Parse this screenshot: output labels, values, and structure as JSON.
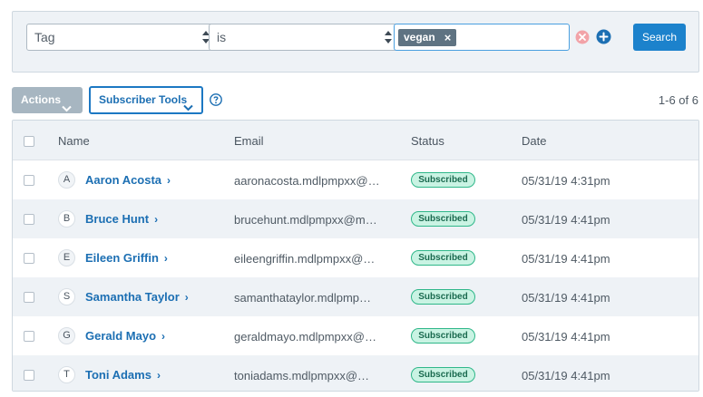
{
  "filter": {
    "field_value": "Tag",
    "operator_value": "is",
    "tag_chip": "vegan",
    "tag_remove_glyph": "×",
    "search_label": "Search",
    "clear_icon": "clear-circle-icon",
    "add_icon": "add-circle-icon"
  },
  "toolbar": {
    "actions_label": "Actions",
    "subscriber_tools_label": "Subscriber Tools",
    "help_icon": "question-circle-icon",
    "pagination": "1-6 of 6"
  },
  "table": {
    "headers": {
      "name": "Name",
      "email": "Email",
      "status": "Status",
      "date": "Date"
    },
    "rows": [
      {
        "initial": "A",
        "name": "Aaron Acosta",
        "email": "aaronacosta.mdlpmpxx@…",
        "status": "Subscribed",
        "date": "05/31/19 4:31pm"
      },
      {
        "initial": "B",
        "name": "Bruce Hunt",
        "email": "brucehunt.mdlpmpxx@m…",
        "status": "Subscribed",
        "date": "05/31/19 4:41pm"
      },
      {
        "initial": "E",
        "name": "Eileen Griffin",
        "email": "eileengriffin.mdlpmpxx@…",
        "status": "Subscribed",
        "date": "05/31/19 4:41pm"
      },
      {
        "initial": "S",
        "name": "Samantha Taylor",
        "email": "samanthataylor.mdlpmp…",
        "status": "Subscribed",
        "date": "05/31/19 4:41pm"
      },
      {
        "initial": "G",
        "name": "Gerald Mayo",
        "email": "geraldmayo.mdlpmpxx@…",
        "status": "Subscribed",
        "date": "05/31/19 4:41pm"
      },
      {
        "initial": "T",
        "name": "Toni Adams",
        "email": "toniadams.mdlpmpxx@…",
        "status": "Subscribed",
        "date": "05/31/19 4:41pm"
      }
    ]
  },
  "colors": {
    "primary": "#1c82cc",
    "link": "#1c6fb3",
    "badge_bg": "#c9f3e3",
    "badge_border": "#2fb789",
    "row_alt": "#eef2f6",
    "clear_icon": "#f2a3a8"
  }
}
